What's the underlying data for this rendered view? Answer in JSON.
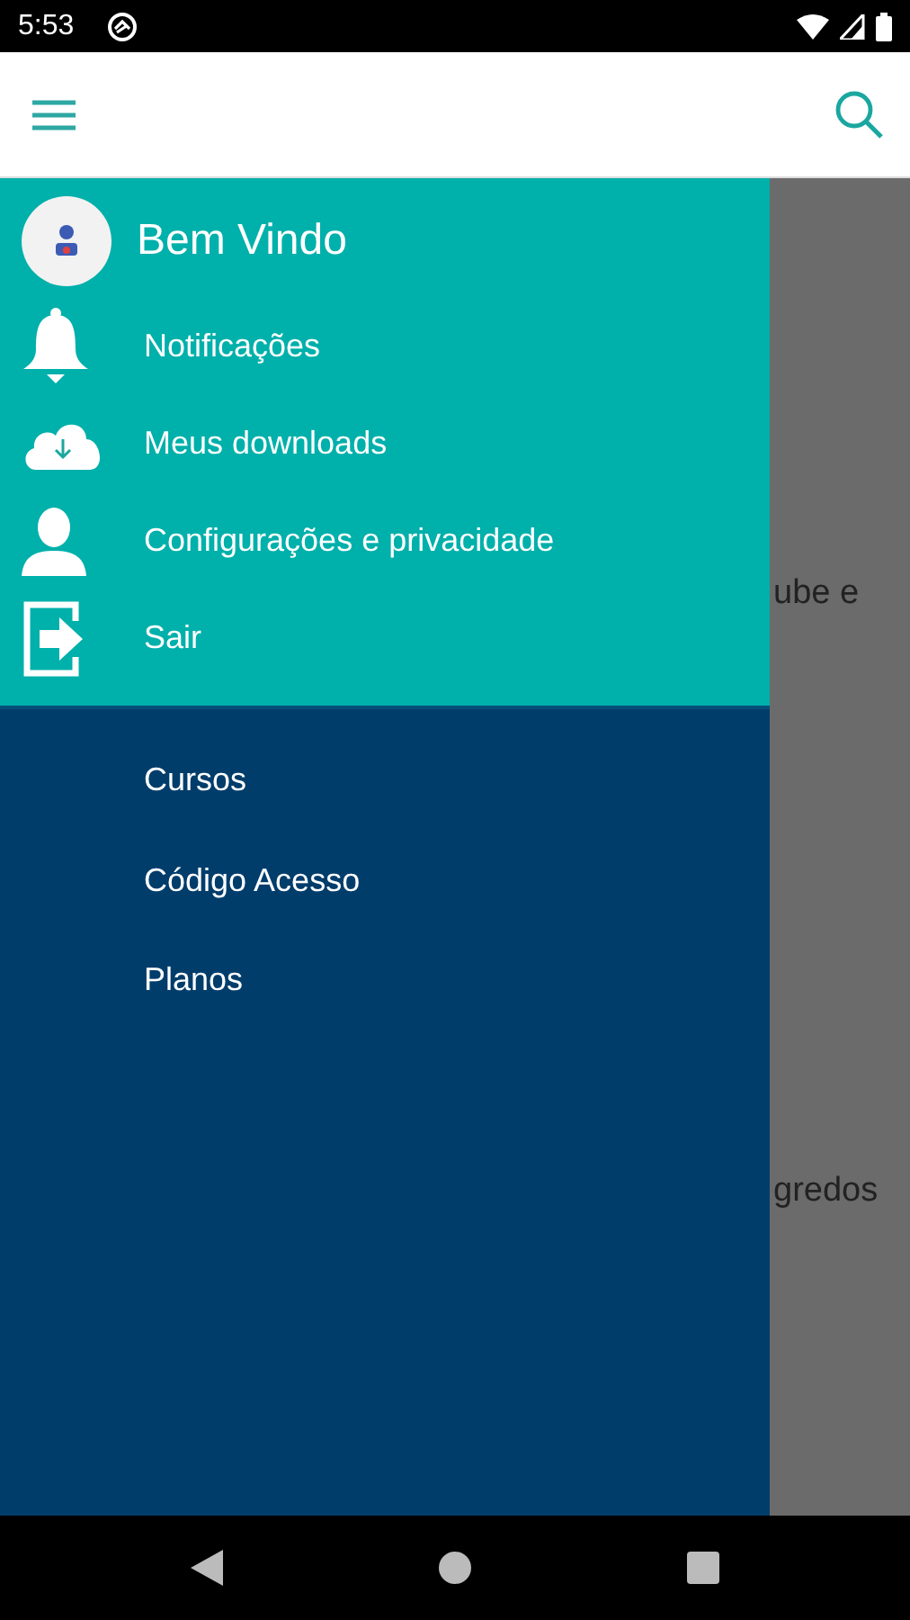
{
  "status_bar": {
    "time": "5:53"
  },
  "drawer": {
    "header": {
      "title": "Bem Vindo"
    },
    "items": [
      {
        "label": "Notificações"
      },
      {
        "label": "Meus downloads"
      },
      {
        "label": "Configurações e privacidade"
      },
      {
        "label": "Sair"
      }
    ],
    "links": [
      {
        "label": "Cursos"
      },
      {
        "label": "Código Acesso"
      },
      {
        "label": "Planos"
      }
    ]
  },
  "background_texts": [
    "ube e",
    "gredos"
  ]
}
